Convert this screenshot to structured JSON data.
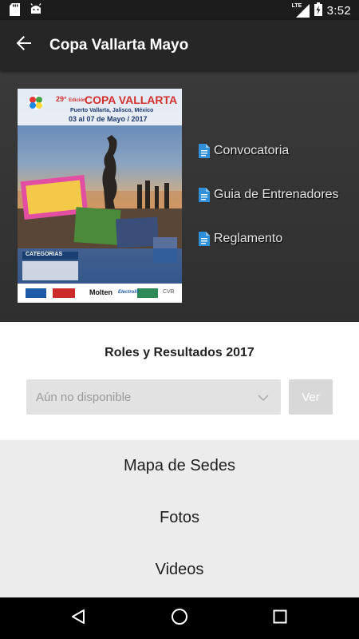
{
  "status_bar": {
    "time": "3:52",
    "network": "LTE",
    "icons": [
      "sd-card-icon",
      "android-icon",
      "lte-signal-icon",
      "battery-charging-icon"
    ]
  },
  "app_bar": {
    "title": "Copa Vallarta Mayo",
    "back_icon": "arrow-back-icon"
  },
  "poster": {
    "edition": "29°",
    "edition_suffix": "Edición",
    "title": "COPA VALLARTA",
    "location": "Puerto Vallarta, Jalisco, México",
    "dates": "03 al 07 de Mayo / 2017",
    "banner": "CATEGORIAS",
    "sponsors": [
      "Molten",
      "Electrolit",
      "CVB"
    ]
  },
  "documents": [
    {
      "label": "Convocatoria",
      "icon": "document-icon"
    },
    {
      "label": "Guia de Entrenadores",
      "icon": "document-icon"
    },
    {
      "label": "Reglamento",
      "icon": "document-icon"
    }
  ],
  "results": {
    "title": "Roles y Resultados 2017",
    "select_value": "Aún no disponible",
    "button_label": "Ver"
  },
  "menu": {
    "items": [
      "Mapa de Sedes",
      "Fotos",
      "Videos"
    ]
  },
  "colors": {
    "app_bar": "#262626",
    "hero_bg": "#353535",
    "doc_icon": "#2f8fd8",
    "menu_bg": "#ececec"
  }
}
